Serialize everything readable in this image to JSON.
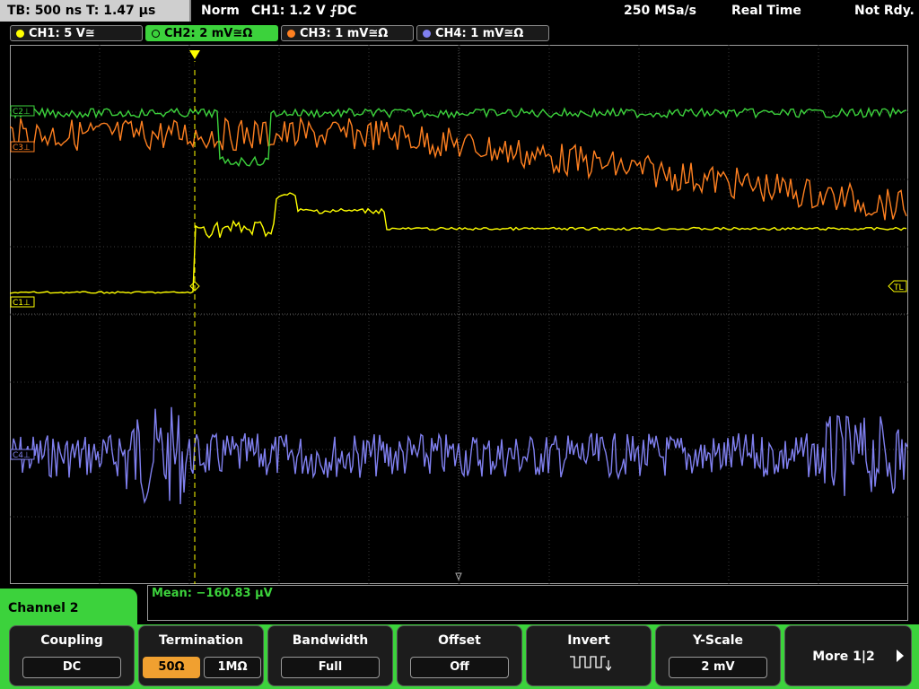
{
  "topbar": {
    "timebase": "TB: 500 ns   T: 1.47 µs",
    "mode": "Norm",
    "trigger": "CH1: 1.2 V ⨍DC",
    "sample_rate": "250 MSa/s",
    "acq_mode": "Real Time",
    "status": "Not Rdy."
  },
  "channels": [
    {
      "label": "CH1: 5 V≅",
      "color": "#ffff00"
    },
    {
      "label": "CH2: 2 mV≅Ω",
      "color": "#3cd23c"
    },
    {
      "label": "CH3: 1 mV≅Ω",
      "color": "#ff8020"
    },
    {
      "label": "CH4: 1 mV≅Ω",
      "color": "#8080f0"
    }
  ],
  "markers": {
    "c2": "C2⊥",
    "c3": "C3⊥",
    "c1": "C1⊥",
    "c4": "C4⊥",
    "tl": "TL",
    "trig": "T"
  },
  "measurement": {
    "mean": "Mean: −160.83 µV"
  },
  "menu": {
    "title": "Channel 2",
    "coupling": {
      "title": "Coupling",
      "value": "DC"
    },
    "termination": {
      "title": "Termination",
      "opt1": "50Ω",
      "opt2": "1MΩ"
    },
    "bandwidth": {
      "title": "Bandwidth",
      "value": "Full"
    },
    "offset": {
      "title": "Offset",
      "value": "Off"
    },
    "invert": {
      "title": "Invert",
      "icon": "inverted-square-wave-icon"
    },
    "yscale": {
      "title": "Y-Scale",
      "value": "2 mV"
    },
    "more": {
      "label": "More 1|2"
    }
  }
}
